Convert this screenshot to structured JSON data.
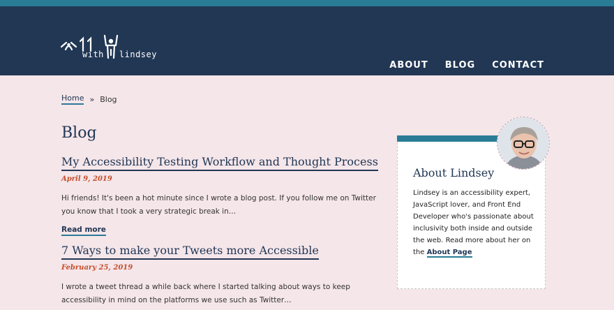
{
  "site": {
    "logo_line1": "with",
    "logo_line2": "lindsey"
  },
  "nav": {
    "items": [
      {
        "label": "ABOUT"
      },
      {
        "label": "BLOG"
      },
      {
        "label": "CONTACT"
      }
    ]
  },
  "breadcrumb": {
    "home": "Home",
    "separator": "»",
    "current": "Blog"
  },
  "page": {
    "title": "Blog"
  },
  "posts": [
    {
      "title": "My Accessibility Testing Workflow and Thought Process",
      "date": "April 9, 2019",
      "excerpt": "Hi friends! It's been a hot minute since I wrote a blog post. If you follow me on Twitter you know that I took a very strategic break in…",
      "read_more": "Read more"
    },
    {
      "title": "7 Ways to make your Tweets more Accessible",
      "date": "February 25, 2019",
      "excerpt": "I wrote a tweet thread a while back where I started talking about ways to keep accessibility in mind on the platforms we use such as Twitter…"
    }
  ],
  "about": {
    "title": "About Lindsey",
    "text": "Lindsey is an accessibility expert, JavaScript lover, and Front End Developer who's passionate about inclusivity both inside and outside the web. Read more about her on the ",
    "link": "About Page"
  },
  "colors": {
    "header_bg": "#213754",
    "accent": "#2a7c96",
    "page_bg": "#f5e6ea",
    "date": "#c44e2a"
  }
}
